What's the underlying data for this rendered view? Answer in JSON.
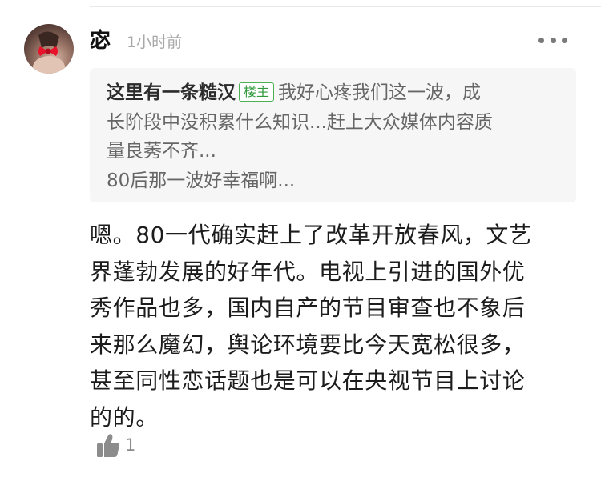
{
  "comment": {
    "username": "宓",
    "time": "1小时前",
    "quote": {
      "author": "这里有一条糙汉",
      "badge": "楼主",
      "line1": "我好心疼我们这一波，成",
      "line2": "长阶段中没积累什么知识...赶上大众媒体内容质",
      "line3": "量良莠不齐...",
      "line4": "80后那一波好幸福啊..."
    },
    "body": {
      "line1": "嗯。80一代确实赶上了改革开放春风，文艺",
      "line2": "界蓬勃发展的好年代。电视上引进的国外优",
      "line3": "秀作品也多，国内自产的节目审查也不象后",
      "line4": "来那么魔幻，舆论环境要比今天宽松很多，",
      "line5": "甚至同性恋话题也是可以在央视节目上讨论",
      "line6": "的的。"
    },
    "like_count": "1"
  },
  "icons": {
    "avatar": "avatar-red-bow",
    "more": "more-dots-icon",
    "like": "thumbs-up-icon"
  },
  "colors": {
    "badge_green": "#4cb050",
    "muted_text": "#a8a8a8",
    "quote_background": "#f6f6f6"
  }
}
